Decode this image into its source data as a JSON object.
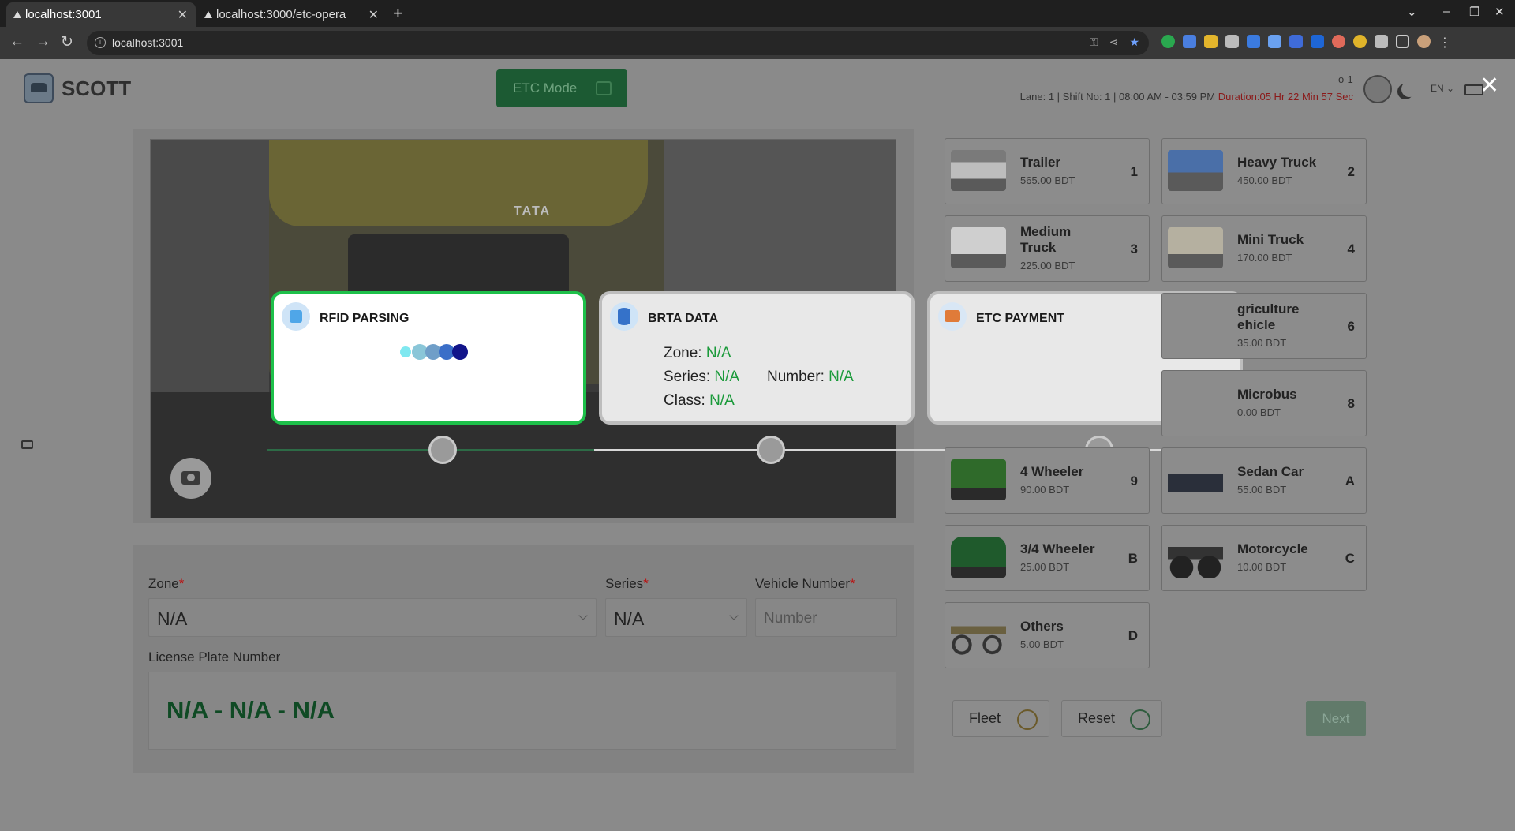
{
  "browser": {
    "tabs": [
      {
        "title": "localhost:3001",
        "active": true
      },
      {
        "title": "localhost:3000/etc-opera",
        "active": false
      }
    ],
    "url": "localhost:3001"
  },
  "header": {
    "brand": "SCOTT",
    "mode_button": "ETC Mode",
    "user_id": "o-1",
    "lane": "Lane: 1 |",
    "shift": "Shift No: 1 |",
    "time_range": "08:00 AM - 03:59 PM",
    "duration": "Duration:05 Hr 22 Min 57 Sec",
    "language": "EN"
  },
  "steps": [
    {
      "title": "RFID PARSING",
      "status": "active"
    },
    {
      "title": "BRTA DATA",
      "status": "pending"
    },
    {
      "title": "ETC PAYMENT",
      "status": "pending"
    }
  ],
  "brta": {
    "zone_label": "Zone:",
    "zone_value": "N/A",
    "series_label": "Series:",
    "series_value": "N/A",
    "number_label": "Number:",
    "number_value": "N/A",
    "class_label": "Class:",
    "class_value": "N/A"
  },
  "form": {
    "zone_label": "Zone",
    "zone_value": "N/A",
    "series_label": "Series",
    "series_value": "N/A",
    "vehicle_number_label": "Vehicle Number",
    "vehicle_number_placeholder": "Number",
    "license_label": "License Plate Number",
    "license_value": "N/A - N/A - N/A",
    "required_mark": "*"
  },
  "vehicles": [
    {
      "name": "Trailer",
      "price": "565.00 BDT",
      "key": "1"
    },
    {
      "name": "Heavy Truck",
      "price": "450.00 BDT",
      "key": "2"
    },
    {
      "name": "Medium Truck",
      "price": "225.00 BDT",
      "key": "3"
    },
    {
      "name": "Mini Truck",
      "price": "170.00 BDT",
      "key": "4"
    },
    {
      "name": "griculture ehicle",
      "price": "35.00 BDT",
      "key": "6"
    },
    {
      "name": "Microbus",
      "price": "0.00 BDT",
      "key": "8"
    },
    {
      "name": "4 Wheeler",
      "price": "90.00 BDT",
      "key": "9"
    },
    {
      "name": "Sedan Car",
      "price": "55.00 BDT",
      "key": "A"
    },
    {
      "name": "3/4 Wheeler",
      "price": "25.00 BDT",
      "key": "B"
    },
    {
      "name": "Motorcycle",
      "price": "10.00 BDT",
      "key": "C"
    },
    {
      "name": "Others",
      "price": "5.00 BDT",
      "key": "D"
    }
  ],
  "buttons": {
    "fleet": "Fleet",
    "reset": "Reset",
    "next": "Next"
  },
  "camera": {
    "plate_brand": "TATA"
  },
  "colors": {
    "active_border": "#1ec04a",
    "na_value": "#1a9a3a",
    "mode_button": "#1c5a33",
    "duration": "#8b1a1a"
  }
}
